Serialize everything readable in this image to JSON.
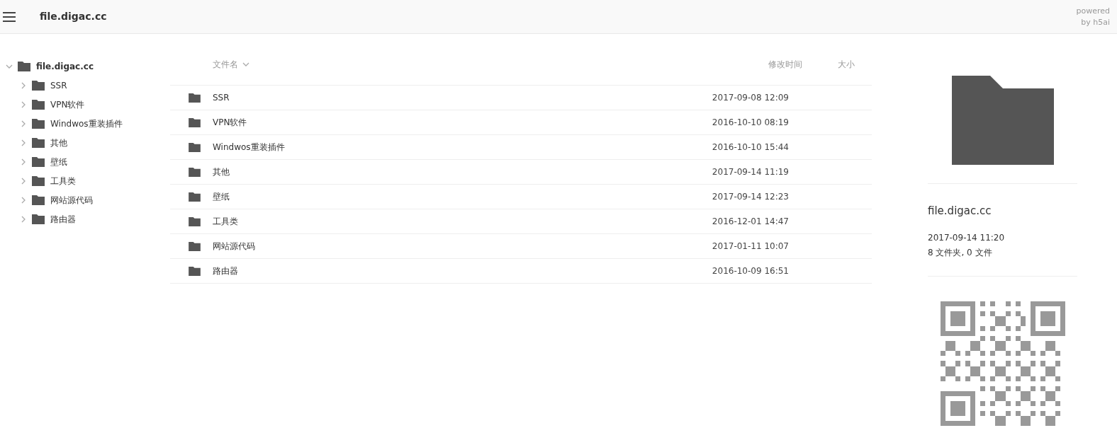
{
  "topbar": {
    "title": "file.digac.cc",
    "powered": [
      "powered",
      "by h5ai"
    ]
  },
  "tree": {
    "label": "file.digac.cc",
    "expanded": true,
    "children": [
      {
        "label": "SSR",
        "expanded": false
      },
      {
        "label": "VPN软件",
        "expanded": false
      },
      {
        "label": "Windwos重装插件",
        "expanded": false
      },
      {
        "label": "其他",
        "expanded": false
      },
      {
        "label": "壁纸",
        "expanded": false
      },
      {
        "label": "工具类",
        "expanded": false
      },
      {
        "label": "网站源代码",
        "expanded": false
      },
      {
        "label": "路由器",
        "expanded": false
      }
    ]
  },
  "table": {
    "columns": [
      {
        "label": "文件名",
        "sorted": true
      },
      {
        "label": "修改时间",
        "sorted": false
      },
      {
        "label": "大小",
        "sorted": false
      }
    ],
    "rows": [
      {
        "name": "SSR",
        "modified": "2017-09-08 12:09"
      },
      {
        "name": "VPN软件",
        "modified": "2016-10-10 08:19"
      },
      {
        "name": "Windwos重装插件",
        "modified": "2016-10-10 15:44"
      },
      {
        "name": "其他",
        "modified": "2017-09-14 11:19"
      },
      {
        "name": "壁纸",
        "modified": "2017-09-14 12:23"
      },
      {
        "name": "工具类",
        "modified": "2016-12-01 14:47"
      },
      {
        "name": "网站源代码",
        "modified": "2017-01-11 10:07"
      },
      {
        "name": "路由器",
        "modified": "2016-10-09 16:51"
      }
    ]
  },
  "info": {
    "name": "file.digac.cc",
    "modified": "2017-09-14 11:20",
    "folders": "8",
    "folders_label": "文件夹,",
    "files": "0",
    "files_label": "文件"
  }
}
